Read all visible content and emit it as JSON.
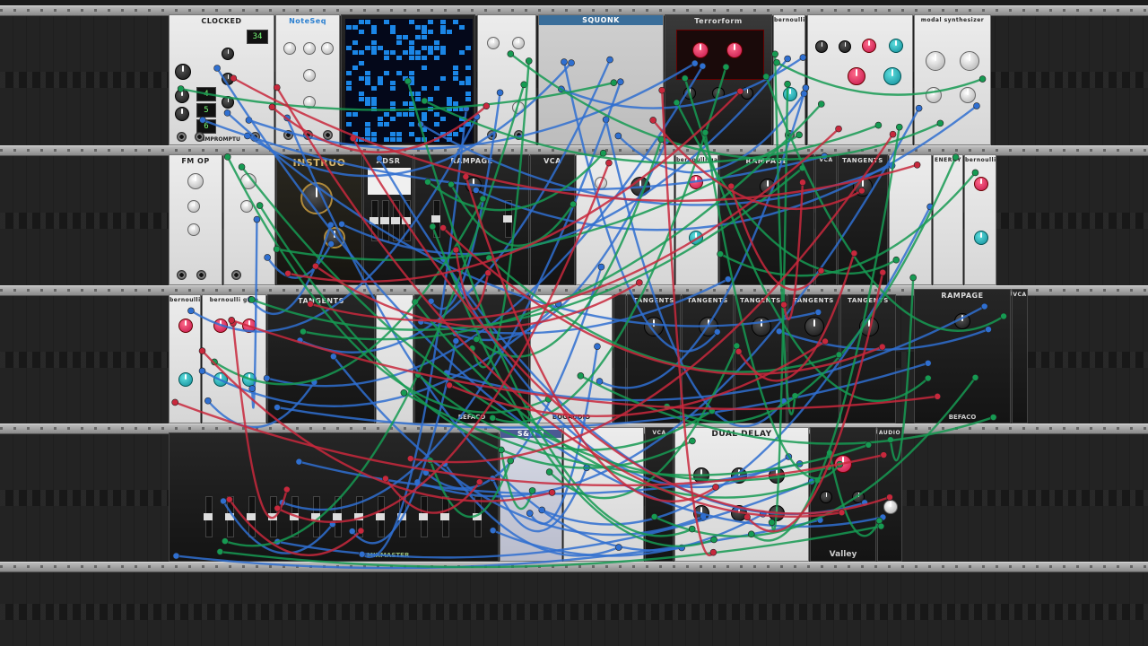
{
  "rack": {
    "rows": [
      {
        "modules": [
          {
            "title": "CLOCKED",
            "theme": "light",
            "foot": "IMPROMPTU",
            "displays": [
              "34",
              "4",
              "5",
              "6"
            ]
          },
          {
            "title": "NoteSeq",
            "theme": "light",
            "foot": ""
          },
          {
            "title": "",
            "theme": "dark",
            "foot": "",
            "kind": "grid"
          },
          {
            "title": "",
            "theme": "light",
            "foot": ""
          },
          {
            "title": "SQUONK",
            "theme": "mid",
            "foot": ""
          },
          {
            "title": "Terrorform",
            "theme": "dark",
            "foot": ""
          },
          {
            "title": "bernoulli gate",
            "theme": "light",
            "foot": ""
          },
          {
            "title": "",
            "theme": "light",
            "foot": ""
          },
          {
            "title": "modal synthesizer",
            "theme": "light",
            "foot": ""
          }
        ]
      },
      {
        "modules": [
          {
            "title": "FM OP",
            "theme": "light",
            "foot": ""
          },
          {
            "title": "",
            "theme": "light",
            "foot": ""
          },
          {
            "title": "INSTRUO",
            "theme": "dark",
            "foot": ""
          },
          {
            "title": "ADSR",
            "theme": "dark",
            "foot": ""
          },
          {
            "title": "RAMPAGE",
            "theme": "dark",
            "foot": "RAMPAGE"
          },
          {
            "title": "VCA",
            "theme": "dark",
            "foot": ""
          },
          {
            "title": "",
            "theme": "light",
            "foot": ""
          },
          {
            "title": "bernoulli gate",
            "theme": "light",
            "foot": ""
          },
          {
            "title": "RAMPAGE",
            "theme": "dark",
            "foot": ""
          },
          {
            "title": "VCA",
            "theme": "dark",
            "foot": ""
          },
          {
            "title": "TANGENTS",
            "theme": "dark",
            "foot": ""
          },
          {
            "title": "",
            "theme": "light",
            "foot": ""
          },
          {
            "title": "ENERGY",
            "theme": "light",
            "foot": ""
          },
          {
            "title": "bernoulli gate",
            "theme": "light",
            "foot": ""
          }
        ]
      },
      {
        "modules": [
          {
            "title": "bernoulli gate",
            "theme": "light",
            "foot": ""
          },
          {
            "title": "bernoulli gate",
            "theme": "light",
            "foot": ""
          },
          {
            "title": "TANGENTS",
            "theme": "dark",
            "foot": ""
          },
          {
            "title": "",
            "theme": "light",
            "foot": ""
          },
          {
            "title": "",
            "theme": "dark",
            "foot": "BEFACO"
          },
          {
            "title": "",
            "theme": "light",
            "foot": "BOGAUDIO"
          },
          {
            "title": "",
            "theme": "dark",
            "foot": ""
          },
          {
            "title": "TANGENTS",
            "theme": "dark",
            "foot": ""
          },
          {
            "title": "TANGENTS",
            "theme": "dark",
            "foot": ""
          },
          {
            "title": "TANGENTS",
            "theme": "dark",
            "foot": ""
          },
          {
            "title": "TANGENTS",
            "theme": "dark",
            "foot": ""
          },
          {
            "title": "TANGENTS",
            "theme": "dark",
            "foot": ""
          },
          {
            "title": "RAMPAGE",
            "theme": "dark",
            "foot": "BEFACO"
          },
          {
            "title": "VCA",
            "theme": "dark",
            "foot": ""
          }
        ]
      },
      {
        "modules": [
          {
            "title": "",
            "theme": "dark",
            "foot": "MIXMASTER"
          },
          {
            "title": "S&H 8",
            "theme": "light",
            "foot": ""
          },
          {
            "title": "",
            "theme": "light",
            "foot": ""
          },
          {
            "title": "VCA",
            "theme": "dark",
            "foot": ""
          },
          {
            "title": "DUAL DELAY",
            "theme": "light",
            "foot": ""
          },
          {
            "title": "",
            "theme": "dark",
            "foot": "Valley"
          },
          {
            "title": "AUDIO",
            "theme": "dark",
            "foot": ""
          }
        ]
      }
    ]
  },
  "colors": {
    "cable_blue": "#2f6fd0",
    "cable_green": "#169a52",
    "cable_red": "#c8283c",
    "grid_cell": "#1b86e6"
  }
}
